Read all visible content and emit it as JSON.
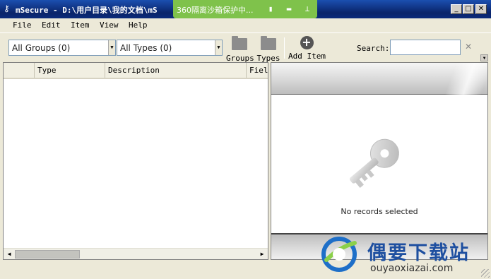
{
  "window": {
    "title": "mSecure - D:\\用户目录\\我的文档\\mS",
    "sandbox_text": "360隔离沙箱保护中...",
    "minimize_label": "_",
    "maximize_label": "□",
    "close_label": "✕"
  },
  "menu": [
    "File",
    "Edit",
    "Item",
    "View",
    "Help"
  ],
  "toolbar": {
    "groups_select": "All Groups (0)",
    "types_select": "All Types (0)",
    "groups_label": "Groups",
    "types_label": "Types",
    "add_item_label": "Add Item",
    "search_label": "Search:",
    "search_value": "",
    "clear_label": "✕"
  },
  "list": {
    "columns": [
      "",
      "Type",
      "Description",
      "Fiel"
    ]
  },
  "details": {
    "empty_message": "No records selected"
  },
  "watermark": {
    "brand": "偶要下载站",
    "url": "ouyaoxiazai.com"
  }
}
